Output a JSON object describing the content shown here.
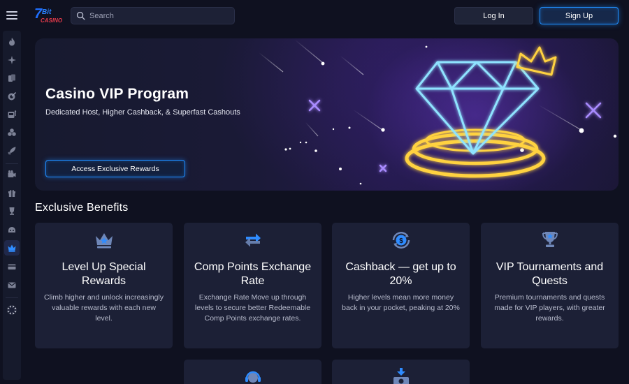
{
  "header": {
    "logo_text": "7Bit CASINO",
    "search_placeholder": "Search",
    "login_label": "Log In",
    "signup_label": "Sign Up"
  },
  "sidebar": {
    "items": [
      {
        "icon": "fire-icon"
      },
      {
        "icon": "sparkle-icon"
      },
      {
        "icon": "cards-icon"
      },
      {
        "icon": "dart-icon"
      },
      {
        "icon": "slot-icon"
      },
      {
        "icon": "dice-icon"
      },
      {
        "icon": "rocket-icon"
      },
      {
        "icon": "camera-icon"
      },
      {
        "icon": "gift-icon"
      },
      {
        "icon": "trophy-icon"
      },
      {
        "icon": "bot-icon"
      },
      {
        "icon": "crown-icon",
        "active": true
      },
      {
        "icon": "card-icon"
      },
      {
        "icon": "mail-icon"
      },
      {
        "icon": "uk-flag-icon"
      }
    ]
  },
  "hero": {
    "title": "Casino VIP Program",
    "subtitle": "Dedicated Host, Higher Cashback, & Superfast Cashouts",
    "button_label": "Access Exclusive Rewards"
  },
  "benefits": {
    "title": "Exclusive Benefits",
    "cards": [
      {
        "icon": "crown-icon",
        "title": "Level Up Special Rewards",
        "description": "Climb higher and unlock increasingly valuable rewards with each new level."
      },
      {
        "icon": "exchange-icon",
        "title": "Comp Points Exchange Rate",
        "description": "Exchange Rate Move up through levels to secure better Redeemable Comp Points exchange rates."
      },
      {
        "icon": "cashback-icon",
        "title": "Cashback — get up to 20%",
        "description": "Higher levels mean more money back in your pocket, peaking at 20%"
      },
      {
        "icon": "trophy-icon",
        "title": "VIP Tournaments and Quests",
        "description": "Premium tournaments and quests made for VIP players, with greater rewards."
      },
      {
        "icon": "support-icon"
      },
      {
        "icon": "money-icon"
      }
    ]
  },
  "colors": {
    "background": "#0f1120",
    "card": "#1c2036",
    "accent_blue": "#1f8fff",
    "neon_gold": "#ffd23f",
    "neon_cyan": "#8fe3ff"
  }
}
